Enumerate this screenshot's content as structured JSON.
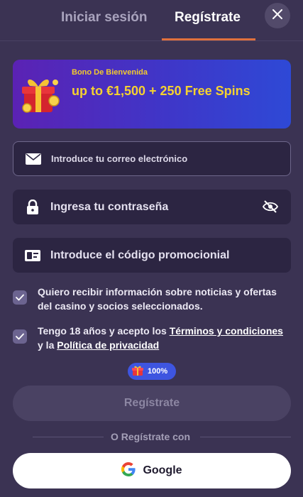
{
  "tabs": {
    "login": "Iniciar sesión",
    "register": "Regístrate"
  },
  "colors": {
    "background": "#3b3353",
    "accent": "#e1713d",
    "banner_text": "#f6d22f",
    "field_bg": "#2c2542",
    "checkbox": "#6c6490"
  },
  "banner": {
    "subtitle": "Bono De Bienvenida",
    "title": "up to €1,500 + 250 Free Spins",
    "icon": "gift-box-icon"
  },
  "form": {
    "email_placeholder": "Introduce tu correo electrónico",
    "password_placeholder": "Ingresa tu contraseña",
    "promo_placeholder": "Introduce el código promocionial",
    "icons": {
      "email": "envelope-icon",
      "password": "lock-icon",
      "promo": "ticket-icon",
      "visibility": "eye-off-icon"
    }
  },
  "consents": {
    "news_text": "Quiero recibir información sobre noticias y ofertas del casino y socios seleccionados.",
    "news_checked": true,
    "terms_prefix": "Tengo 18 años y acepto los ",
    "terms_link": "Términos y condiciones",
    "terms_middle": " y la ",
    "privacy_link": "Política de privacidad",
    "terms_checked": true
  },
  "progress": {
    "label": "100%",
    "value": 100
  },
  "submit_label": "Regístrate",
  "divider_text": "O Regístrate con",
  "google_label": "Google"
}
